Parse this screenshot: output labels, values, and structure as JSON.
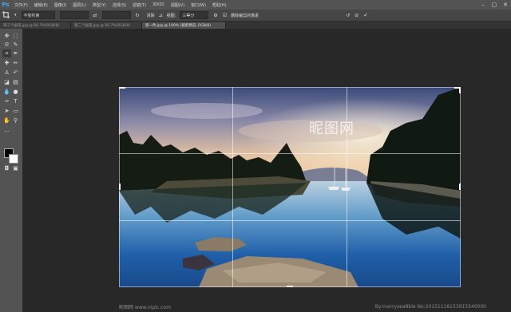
{
  "app": {
    "logo": "Ps"
  },
  "menu": [
    "文件(F)",
    "编辑(E)",
    "图像(I)",
    "图层(L)",
    "类型(Y)",
    "选择(S)",
    "滤镜(T)",
    "3D(D)",
    "视图(V)",
    "窗口(W)",
    "帮助(H)"
  ],
  "window_controls": [
    "–",
    "▢",
    "✕"
  ],
  "options": {
    "ratio": "不受约束",
    "clear": "清除",
    "view_label": "视图:",
    "view_value": "三等分",
    "delete_cropped": "删除裁剪的像素",
    "icons": [
      "crop-tool-icon",
      "swap-icon",
      "rotate-icon",
      "gear-icon",
      "reset-icon",
      "cancel-icon",
      "commit-icon"
    ]
  },
  "tabs": [
    {
      "label": "第三个画笔.jpg @ 66.7%(RGB/8)",
      "active": false
    },
    {
      "label": "第二个画笔.jpg @ 66.7%(RGB/8)",
      "active": false
    },
    {
      "label": "第一件.jpg @ 100% (裁剪预览, RGB/8)",
      "active": true
    }
  ],
  "canvas": {
    "watermark_center": "昵图网",
    "footer_left": "昵图网 www.nipic.com",
    "footer_right": "By:merrysea8ble No:20151118153915540000"
  },
  "colors": {
    "accent": "#3fa9f5",
    "panel": "#535353",
    "workspace": "#282828"
  }
}
